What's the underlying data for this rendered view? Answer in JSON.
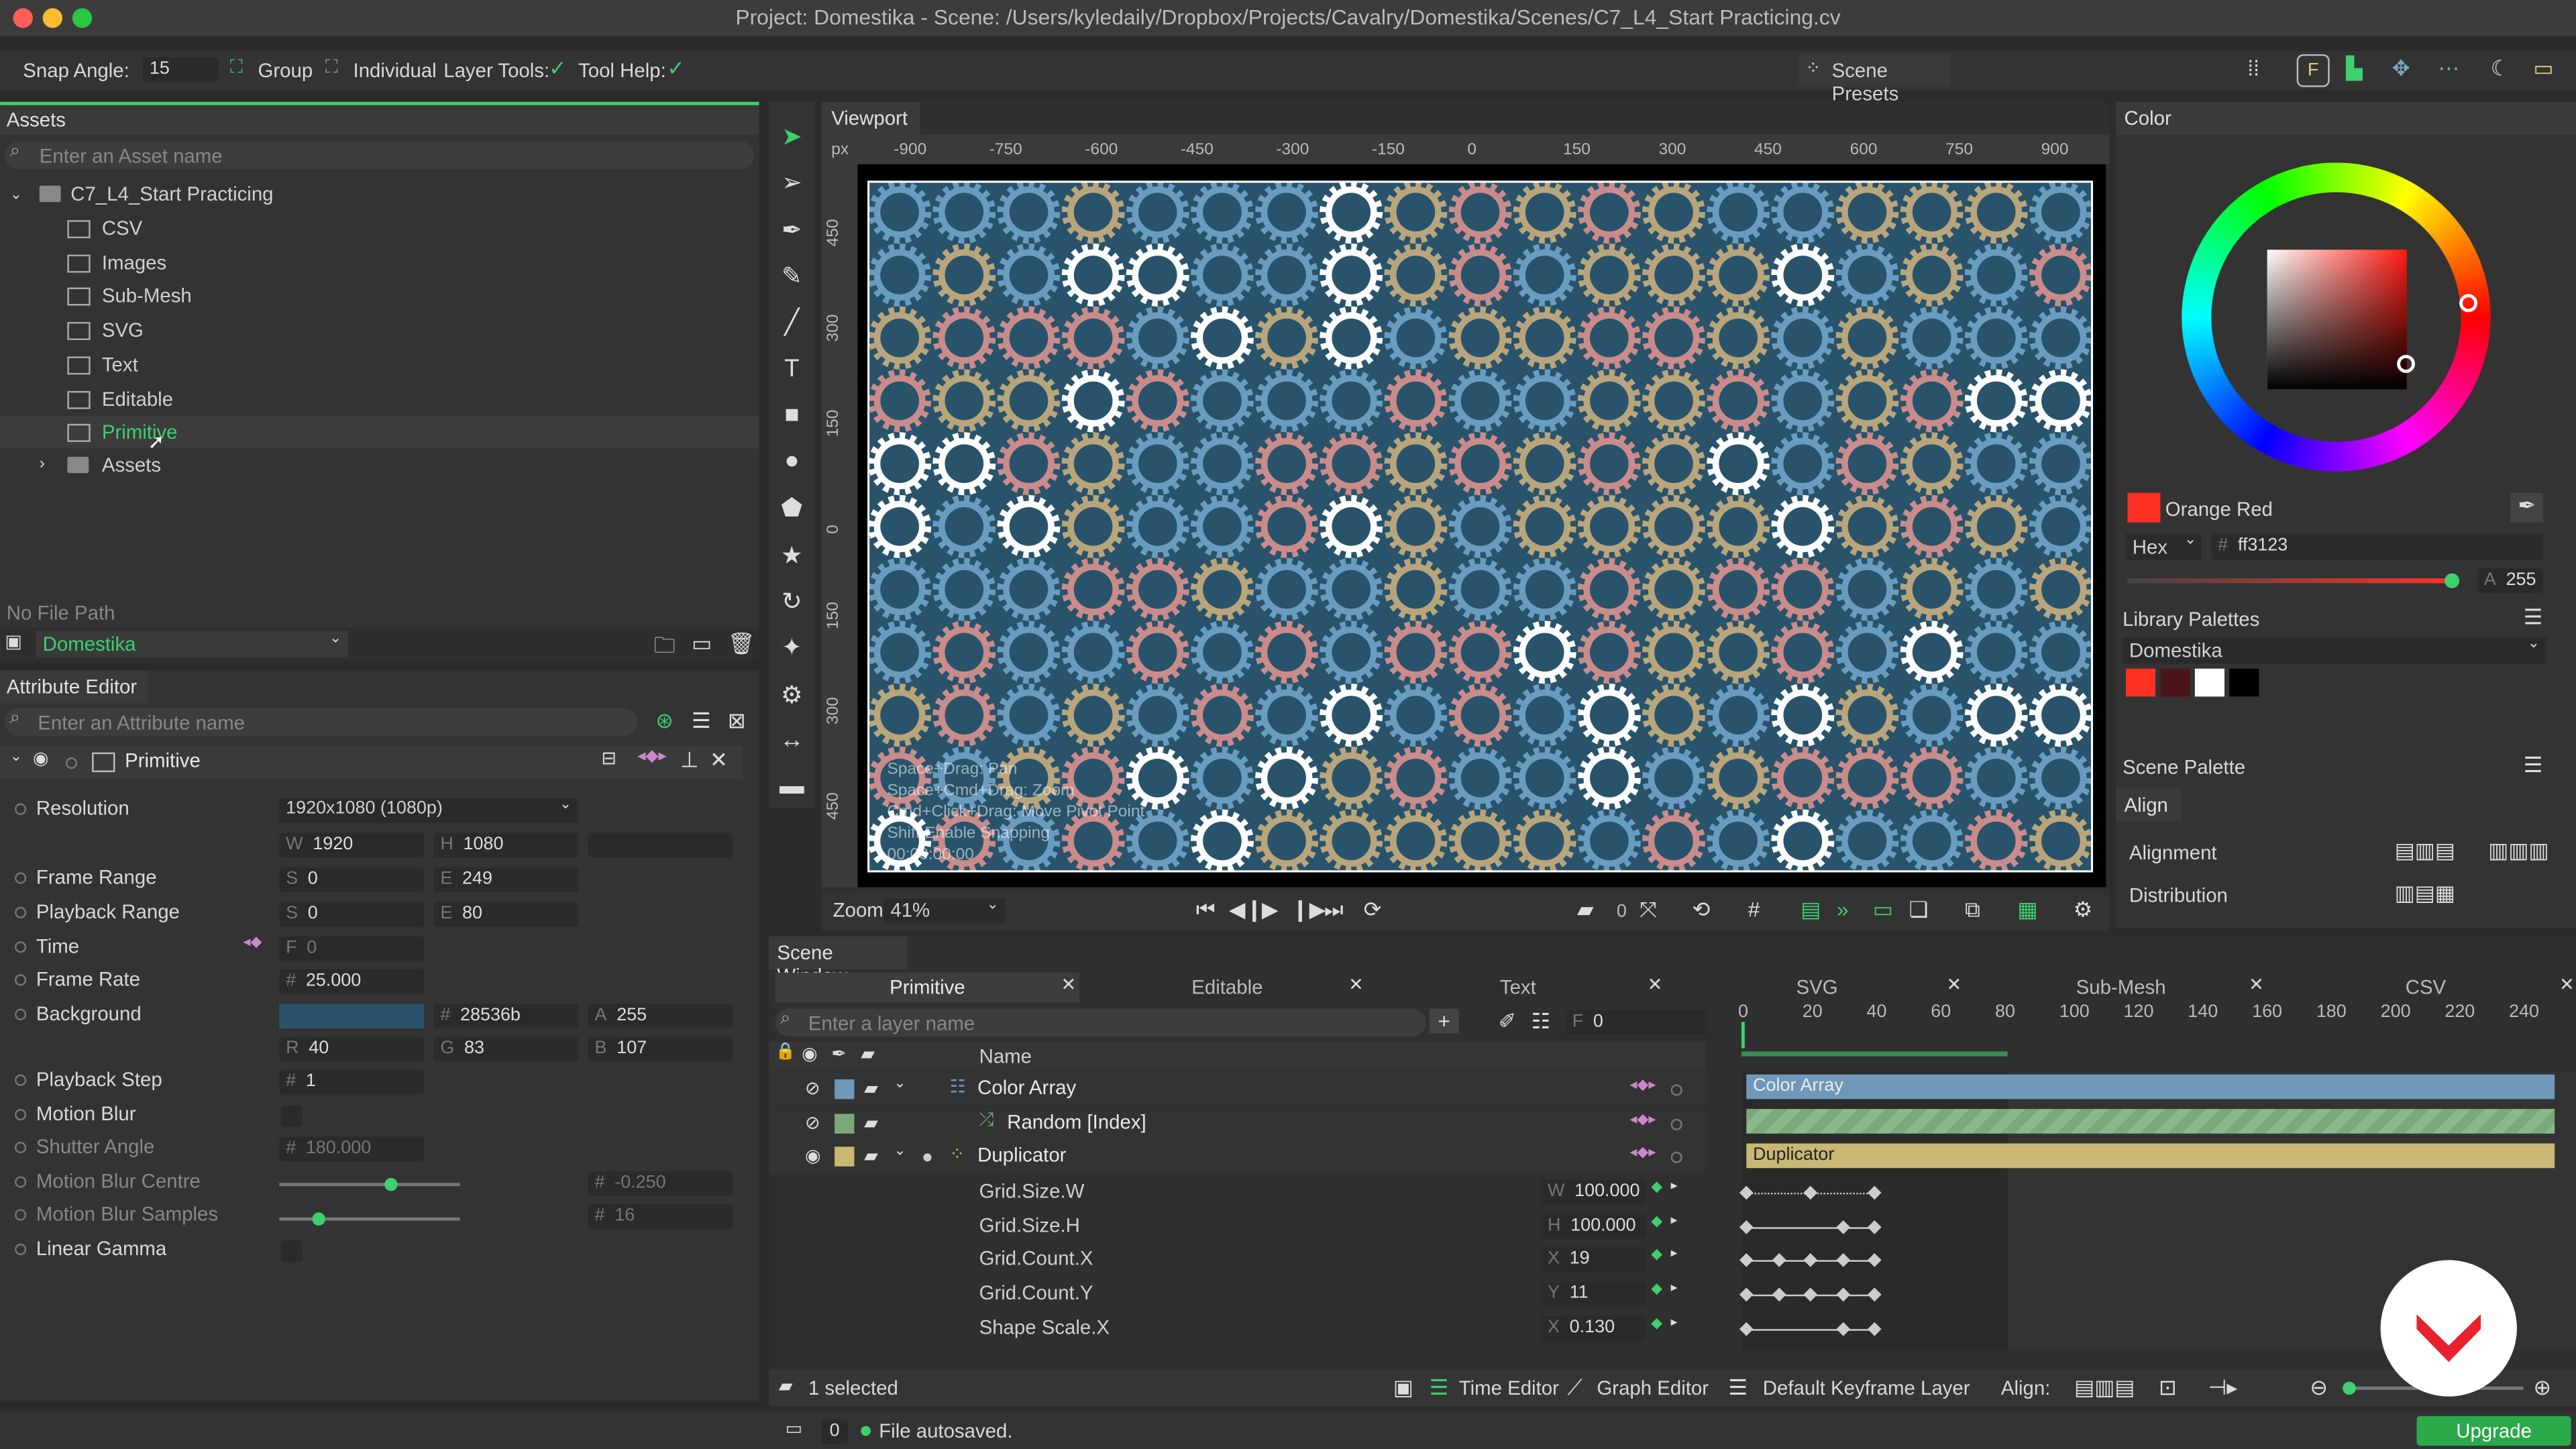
{
  "window": {
    "title": "Project: Domestika - Scene: /Users/kyledaily/Dropbox/Projects/Cavalry/Domestika/Scenes/C7_L4_Start Practicing.cv"
  },
  "toolbar": {
    "snap_label": "Snap Angle:",
    "snap_value": "15",
    "group": "Group",
    "individual": "Individual",
    "layer_tools": "Layer Tools:",
    "tool_help": "Tool Help:",
    "scene_presets": "Scene Presets"
  },
  "assets": {
    "title": "Assets",
    "search_placeholder": "Enter an Asset name",
    "root": "C7_L4_Start Practicing",
    "items": [
      "CSV",
      "Images",
      "Sub-Mesh",
      "SVG",
      "Text",
      "Editable",
      "Primitive"
    ],
    "folder": "Assets",
    "no_file": "No File Path",
    "project": "Domestika"
  },
  "attr": {
    "title": "Attribute Editor",
    "search_placeholder": "Enter an Attribute name",
    "layer": "Primitive",
    "resolution_label": "Resolution",
    "resolution_value": "1920x1080 (1080p)",
    "w": "1920",
    "h": "1080",
    "frame_range_label": "Frame Range",
    "fr_s": "0",
    "fr_e": "249",
    "playback_range_label": "Playback Range",
    "pr_s": "0",
    "pr_e": "80",
    "time_label": "Time",
    "time_f": "0",
    "frame_rate_label": "Frame Rate",
    "frame_rate": "25.000",
    "background_label": "Background",
    "bg_hex": "28536b",
    "bg_a": "255",
    "bg_r": "40",
    "bg_g": "83",
    "bg_b": "107",
    "playback_step_label": "Playback Step",
    "playback_step": "1",
    "motion_blur_label": "Motion Blur",
    "shutter_angle_label": "Shutter Angle",
    "shutter_angle": "180.000",
    "mb_centre_label": "Motion Blur Centre",
    "mb_centre": "-0.250",
    "mb_samples_label": "Motion Blur Samples",
    "mb_samples": "16",
    "linear_gamma_label": "Linear Gamma"
  },
  "viewport": {
    "title": "Viewport",
    "unit": "px",
    "x_ticks": [
      "-900",
      "-750",
      "-600",
      "-450",
      "-300",
      "-150",
      "0",
      "150",
      "300",
      "450",
      "600",
      "750",
      "900"
    ],
    "y_ticks": [
      "450",
      "300",
      "150",
      "0",
      "150",
      "300",
      "450"
    ],
    "help_lines": [
      "Space+Drag: Pan",
      "Space+Cmd+Drag: Zoom",
      "Cmd+Click+Drag: Move Pivot Point",
      "Shift Enable Snapping"
    ],
    "timecode": "00:00:00:00",
    "zoom_label": "Zoom",
    "zoom_value": "41%",
    "frame": "0"
  },
  "color": {
    "title": "Color",
    "name": "Orange Red",
    "mode": "Hex",
    "hex": "ff3123",
    "alpha": "255",
    "library_title": "Library Palettes",
    "library": "Domestika",
    "swatches": [
      "#ff3123",
      "#4a1518",
      "#ffffff",
      "#000000"
    ],
    "scene_palette": "Scene Palette"
  },
  "align": {
    "title": "Align",
    "alignment": "Alignment",
    "distribution": "Distribution"
  },
  "scene": {
    "title": "Scene Window",
    "tabs": [
      "Primitive",
      "Editable",
      "Text",
      "SVG",
      "Sub-Mesh",
      "CSV"
    ],
    "layer_search": "Enter a layer name",
    "frame": "0",
    "name_col": "Name",
    "layers": [
      "Color Array",
      "Random [Index]",
      "Duplicator"
    ],
    "attrs": [
      {
        "name": "Grid.Size.W",
        "axis": "W",
        "value": "100.000"
      },
      {
        "name": "Grid.Size.H",
        "axis": "H",
        "value": "100.000"
      },
      {
        "name": "Grid.Count.X",
        "axis": "X",
        "value": "19"
      },
      {
        "name": "Grid.Count.Y",
        "axis": "Y",
        "value": "11"
      },
      {
        "name": "Shape Scale.X",
        "axis": "X",
        "value": "0.130"
      }
    ],
    "timeline_ticks": [
      "0",
      "20",
      "40",
      "60",
      "80",
      "100",
      "120",
      "140",
      "160",
      "180",
      "200",
      "220",
      "240"
    ],
    "bar_color_array": "Color Array",
    "bar_duplicator": "Duplicator",
    "selected": "1 selected",
    "time_editor": "Time Editor",
    "graph_editor": "Graph Editor",
    "keyframe_layer": "Default Keyframe Layer",
    "align_label": "Align:"
  },
  "status": {
    "message": "File autosaved.",
    "count": "0",
    "upgrade": "Upgrade"
  },
  "colors": {
    "accent": "#3ecf6e",
    "canvas_bg": "#28536b",
    "gear_blue": "#6a9cbf",
    "gear_tan": "#b9a57c",
    "gear_pink": "#c98c8a",
    "gear_white": "#ffffff",
    "duplicator_bar": "#c8b873",
    "brand_red": "#e8212d"
  }
}
